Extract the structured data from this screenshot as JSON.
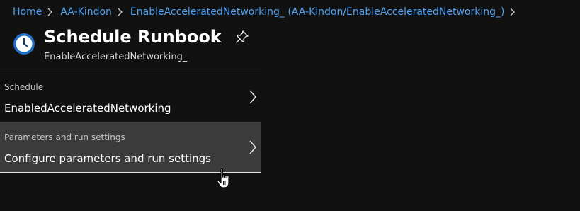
{
  "breadcrumb": {
    "items": [
      "Home",
      "AA-Kindon",
      "EnableAcceleratedNetworking_ (AA-Kindon/EnableAcceleratedNetworking_)"
    ]
  },
  "header": {
    "title": "Schedule Runbook",
    "subtitle": "EnableAcceleratedNetworking_",
    "icon": "clock-icon",
    "pin_icon": "pin-icon"
  },
  "rows": [
    {
      "label": "Schedule",
      "value": "EnabledAcceleratedNetworking"
    },
    {
      "label": "Parameters and run settings",
      "value": "Configure parameters and run settings"
    }
  ],
  "colors": {
    "background": "#111111",
    "link": "#4ea1f3",
    "selected_row": "#3b3b3b",
    "text": "#ffffff"
  }
}
